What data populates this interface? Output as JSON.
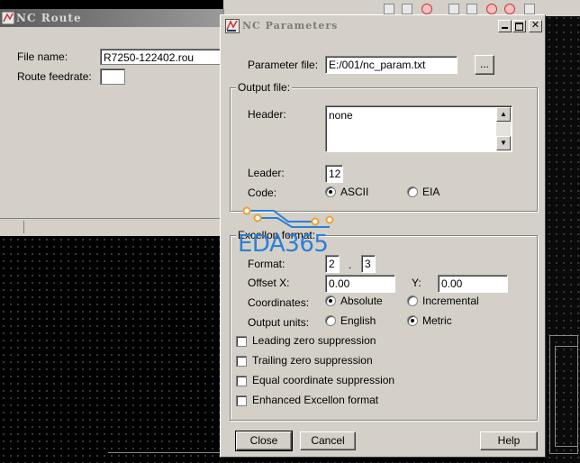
{
  "route_window": {
    "title": "NC Route",
    "file_name_label": "File name:",
    "file_name_value": "R7250-122402.rou",
    "feedrate_label": "Route feedrate:",
    "feedrate_value": ""
  },
  "dialog": {
    "title": "NC Parameters",
    "parameter_file_label": "Parameter file:",
    "parameter_file_value": "E:/001/nc_param.txt",
    "browse_label": "...",
    "output_group": {
      "legend": "Output file:",
      "header_label": "Header:",
      "header_value": "none",
      "leader_label": "Leader:",
      "leader_value": "12",
      "code_label": "Code:",
      "code_options": [
        "ASCII",
        "EIA"
      ],
      "code_selected": "ASCII"
    },
    "excellon_group": {
      "legend": "Excellon format:",
      "format_label": "Format:",
      "format_int": "2",
      "format_sep": ".",
      "format_dec": "3",
      "offset_x_label": "Offset X:",
      "offset_x_value": "0.00",
      "offset_y_label": "Y:",
      "offset_y_value": "0.00",
      "coordinates_label": "Coordinates:",
      "coordinates_options": [
        "Absolute",
        "Incremental"
      ],
      "coordinates_selected": "Absolute",
      "units_label": "Output units:",
      "units_options": [
        "English",
        "Metric"
      ],
      "units_selected": "Metric",
      "checkboxes": [
        {
          "label": "Leading zero suppression",
          "checked": false
        },
        {
          "label": "Trailing zero suppression",
          "checked": false
        },
        {
          "label": "Equal coordinate suppression",
          "checked": false
        },
        {
          "label": "Enhanced Excellon format",
          "checked": false
        }
      ]
    },
    "buttons": {
      "close": "Close",
      "cancel": "Cancel",
      "help": "Help"
    }
  },
  "watermark": {
    "text": "EDA365",
    "color": "#2b7fd8",
    "accent": "#f0a030"
  },
  "icons": [
    "app-icon",
    "minimize-icon",
    "maximize-icon",
    "close-icon",
    "scroll-up-icon",
    "scroll-down-icon"
  ]
}
